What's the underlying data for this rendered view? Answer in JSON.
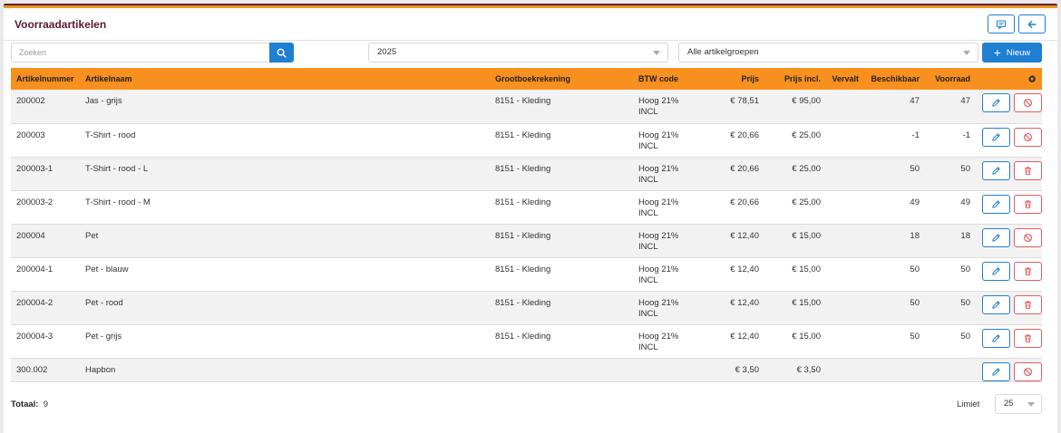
{
  "page": {
    "title": "Voorraadartikelen"
  },
  "header": {
    "comment_icon": "comment-icon",
    "back_icon": "arrow-left-icon"
  },
  "filters": {
    "search_placeholder": "Zoeken",
    "year": "2025",
    "group": "Alle artikelgroepen",
    "new_label": "Nieuw"
  },
  "table": {
    "columns": [
      "Artikelnummer",
      "Artikelnaam",
      "Grootboekrekening",
      "BTW code",
      "Prijs",
      "Prijs incl.",
      "Vervalt",
      "Beschikbaar",
      "Voorraad"
    ],
    "rows": [
      {
        "nr": "200002",
        "name": "Jas - grijs",
        "ledger": "8151 - Kleding",
        "btw1": "Hoog 21%",
        "btw2": "INCL",
        "price": "€ 78,51",
        "price_incl": "€ 95,00",
        "expires": "",
        "available": "47",
        "stock": "47",
        "second_action": "disable"
      },
      {
        "nr": "200003",
        "name": "T-Shirt - rood",
        "ledger": "8151 - Kleding",
        "btw1": "Hoog 21%",
        "btw2": "INCL",
        "price": "€ 20,66",
        "price_incl": "€ 25,00",
        "expires": "",
        "available": "-1",
        "stock": "-1",
        "second_action": "disable"
      },
      {
        "nr": "200003-1",
        "name": "T-Shirt - rood - L",
        "ledger": "8151 - Kleding",
        "btw1": "Hoog 21%",
        "btw2": "INCL",
        "price": "€ 20,66",
        "price_incl": "€ 25,00",
        "expires": "",
        "available": "50",
        "stock": "50",
        "second_action": "delete"
      },
      {
        "nr": "200003-2",
        "name": "T-Shirt - rood - M",
        "ledger": "8151 - Kleding",
        "btw1": "Hoog 21%",
        "btw2": "INCL",
        "price": "€ 20,66",
        "price_incl": "€ 25,00",
        "expires": "",
        "available": "49",
        "stock": "49",
        "second_action": "delete"
      },
      {
        "nr": "200004",
        "name": "Pet",
        "ledger": "8151 - Kleding",
        "btw1": "Hoog 21%",
        "btw2": "INCL",
        "price": "€ 12,40",
        "price_incl": "€ 15,00",
        "expires": "",
        "available": "18",
        "stock": "18",
        "second_action": "disable"
      },
      {
        "nr": "200004-1",
        "name": "Pet - blauw",
        "ledger": "8151 - Kleding",
        "btw1": "Hoog 21%",
        "btw2": "INCL",
        "price": "€ 12,40",
        "price_incl": "€ 15,00",
        "expires": "",
        "available": "50",
        "stock": "50",
        "second_action": "delete"
      },
      {
        "nr": "200004-2",
        "name": "Pet - rood",
        "ledger": "8151 - Kleding",
        "btw1": "Hoog 21%",
        "btw2": "INCL",
        "price": "€ 12,40",
        "price_incl": "€ 15,00",
        "expires": "",
        "available": "50",
        "stock": "50",
        "second_action": "delete"
      },
      {
        "nr": "200004-3",
        "name": "Pet - grijs",
        "ledger": "8151 - Kleding",
        "btw1": "Hoog 21%",
        "btw2": "INCL",
        "price": "€ 12,40",
        "price_incl": "€ 15,00",
        "expires": "",
        "available": "50",
        "stock": "50",
        "second_action": "delete"
      },
      {
        "nr": "300.002",
        "name": "Hapbon",
        "ledger": "",
        "btw1": "",
        "btw2": "",
        "price": "€ 3,50",
        "price_incl": "€ 3,50",
        "expires": "",
        "available": "",
        "stock": "",
        "second_action": "disable"
      }
    ]
  },
  "footer": {
    "total_label": "Totaal:",
    "total_value": "9",
    "limit_label": "Limiet",
    "limit_value": "25"
  },
  "colors": {
    "accent": "#1f7fd1",
    "header_bg": "#f7901e",
    "danger": "#e25b5b",
    "title": "#5a1a2e"
  }
}
